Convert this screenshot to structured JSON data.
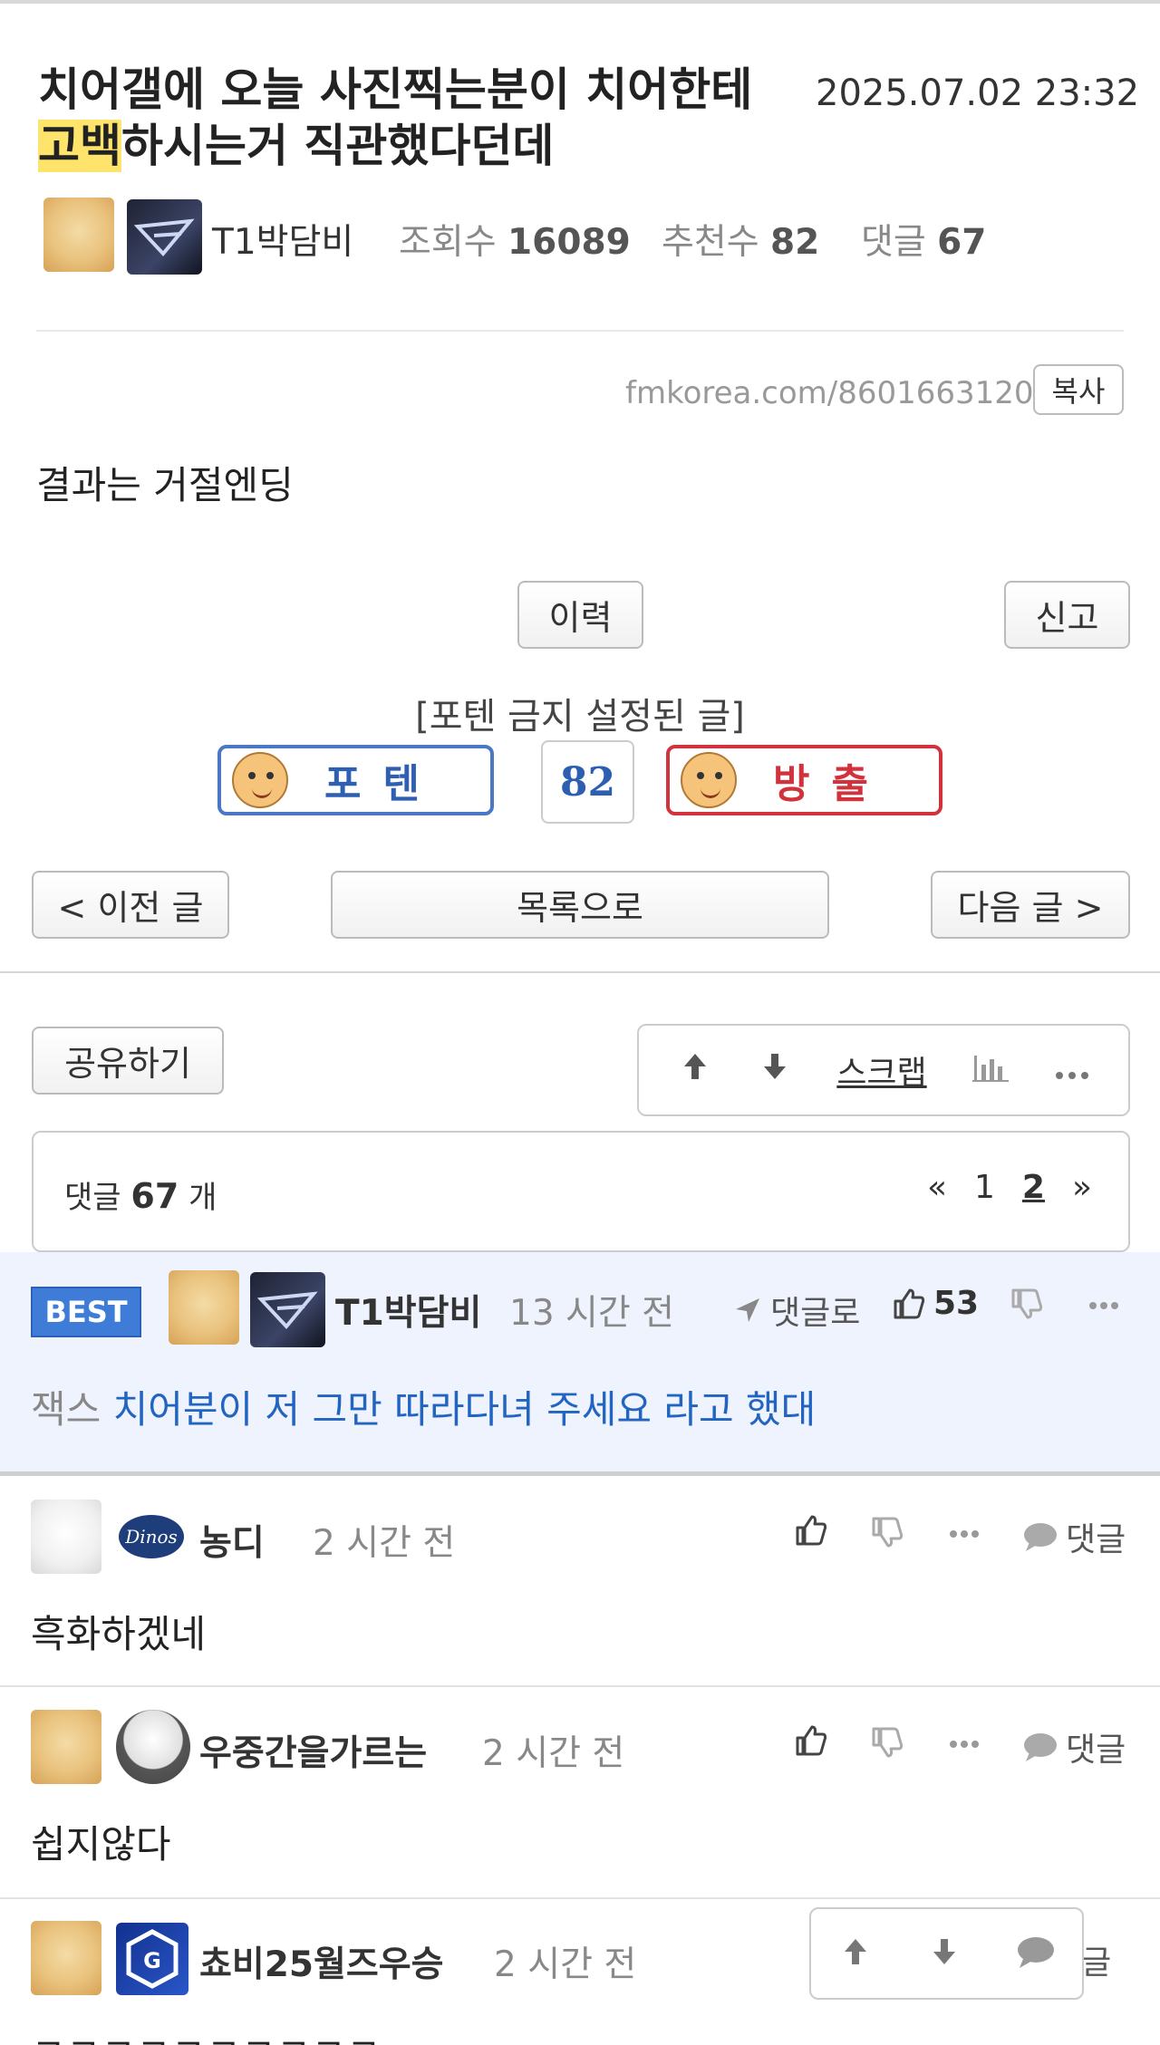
{
  "post": {
    "title_line1": "치어갤에 오늘 사진찍는분이 치어한테",
    "title_highlight": "고백",
    "title_line2_rest": "하시는거 직관했다던데",
    "datetime": "2025.07.02 23:32",
    "author": "T1박담비",
    "views_label": "조회수",
    "views": "16089",
    "recommend_label": "추천수",
    "recommend": "82",
    "comments_label": "댓글",
    "comments": "67",
    "url": "fmkorea.com/8601663120",
    "copy_label": "복사",
    "body": "결과는 거절엔딩",
    "history_label": "이력",
    "report_label": "신고",
    "notice": "[포텐 금지 설정된 글]",
    "vote_up_label": "포텐",
    "vote_count": "82",
    "vote_down_label": "방출"
  },
  "nav": {
    "prev": "< 이전 글",
    "list": "목록으로",
    "next": "다음 글 >"
  },
  "tools": {
    "share": "공유하기",
    "scrap": "스크랩"
  },
  "comment_header": {
    "label": "댓글",
    "count": "67",
    "unit": "개",
    "pages": [
      "«",
      "1",
      "2",
      "»"
    ]
  },
  "best_comment": {
    "badge": "BEST",
    "author": "T1박담비",
    "time": "13 시간 전",
    "reply_label": "댓글로",
    "likes": "53",
    "prefix": "잭스",
    "text": "치어분이 저 그만 따라다녀 주세요 라고 했대"
  },
  "comments": [
    {
      "author": "농디",
      "time": "2 시간 전",
      "text": "흑화하겠네",
      "reply": "댓글"
    },
    {
      "author": "우중간을가르는",
      "time": "2 시간 전",
      "text": "쉽지않다",
      "reply": "댓글"
    },
    {
      "author": "쵸비25월즈우승",
      "time": "2 시간 전",
      "text": "ㅋㅋㅋㅋㅋㅋㅋㅋㅋㅋ",
      "reply": "댓글"
    }
  ],
  "colors": {
    "accent_blue": "#3e7cd8",
    "highlight": "#ffe46b",
    "vote_up": "#4a78c6",
    "vote_down": "#d2323c",
    "best_bg": "#eef3fd"
  }
}
